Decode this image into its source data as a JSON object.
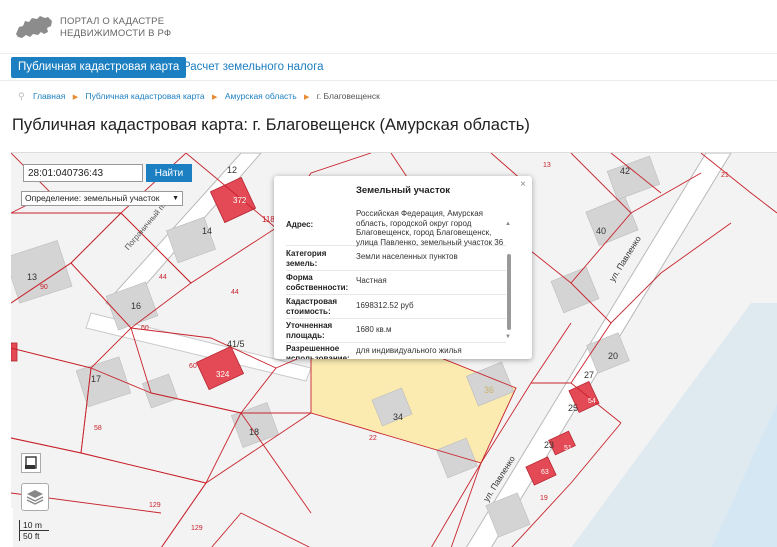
{
  "header": {
    "logo_line1": "ПОРТАЛ О КАДАСТРЕ",
    "logo_line2": "НЕДВИЖИМОСТИ В РФ"
  },
  "nav": {
    "tabs": [
      {
        "label": "Публичная кадастровая карта",
        "active": true
      },
      {
        "label": "Расчет земельного налога",
        "active": false
      }
    ]
  },
  "breadcrumb": {
    "items": [
      "Главная",
      "Публичная кадастровая карта",
      "Амурская область"
    ],
    "current": "г. Благовещенск"
  },
  "page_title": "Публичная кадастровая карта: г. Благовещенск (Амурская область)",
  "map": {
    "search_value": "28:01:040736:43",
    "search_button": "Найти",
    "mode_label": "Определение:",
    "mode_value": "земельный участок",
    "scale_metric": "10 m",
    "scale_imperial": "50 ft",
    "street_pavlenko_top": "ул. Павленко",
    "street_pavlenko_bottom": "ул. Павленко",
    "lane": "Пограничный пер.",
    "colors": {
      "accent": "#1c7fc1",
      "parcel_border": "#c8232c",
      "building": "#e34a55",
      "selected_parcel": "#fbe9a4",
      "water": "#d5e7f3"
    },
    "labels": {
      "n12": "12",
      "n372": "372",
      "n118": "118",
      "n14": "14",
      "n13": "13",
      "n90": "90",
      "n44a": "44",
      "n44b": "44",
      "n16": "16",
      "n60a": "60",
      "n60b": "60",
      "n41": "41/5",
      "n324": "324",
      "n17": "17",
      "n58": "58",
      "n18": "18",
      "n22": "22",
      "n34": "34",
      "n36": "36",
      "n129a": "129",
      "n129b": "129",
      "n13r": "13",
      "n42": "42",
      "n21": "21",
      "n40": "40",
      "n20": "20",
      "n27": "27",
      "n25": "25",
      "n54": "54",
      "n23": "23",
      "n51": "51",
      "n63": "63",
      "n19": "19"
    }
  },
  "popup": {
    "title": "Земельный участок",
    "close": "×",
    "rows": [
      {
        "label": "Адрес:",
        "value": "Российская Федерация, Амурская область, городской округ город Благовещенск, город Благовещенск, улица Павленко, земельный участок 36"
      },
      {
        "label": "Категория земель:",
        "value": "Земли населенных пунктов"
      },
      {
        "label": "Форма собственности:",
        "value": "Частная"
      },
      {
        "label": "Кадастровая стоимость:",
        "value": "1698312.52 руб"
      },
      {
        "label": "Уточненная площадь:",
        "value": "1680 кв.м"
      },
      {
        "label": "Разрешенное использование:",
        "value": "для индивидуального жилья"
      }
    ]
  }
}
